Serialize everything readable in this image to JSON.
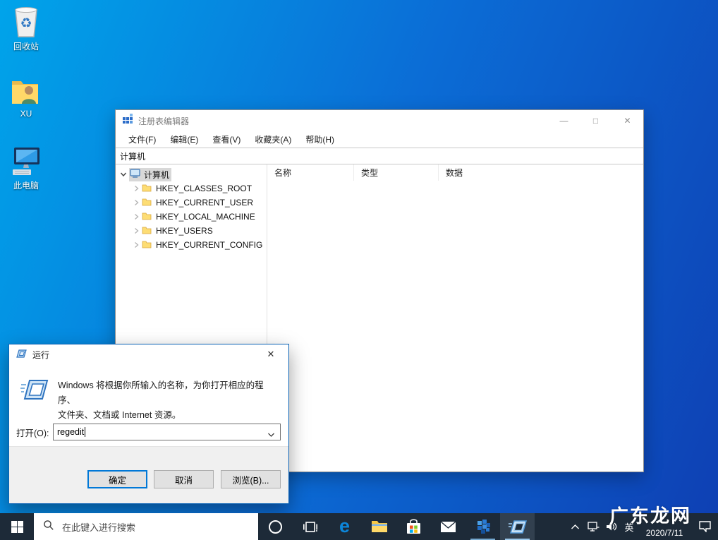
{
  "watermark": {
    "text": "广东龙网"
  },
  "desktop": {
    "icons": [
      {
        "label": "回收站"
      },
      {
        "label": "XU"
      },
      {
        "label": "此电脑"
      }
    ]
  },
  "regedit": {
    "title": "注册表编辑器",
    "window_controls": {
      "minimize": "—",
      "maximize": "□",
      "close": "✕"
    },
    "menus": [
      {
        "label": "文件(F)"
      },
      {
        "label": "编辑(E)"
      },
      {
        "label": "查看(V)"
      },
      {
        "label": "收藏夹(A)"
      },
      {
        "label": "帮助(H)"
      }
    ],
    "address": "计算机",
    "tree": {
      "root": "计算机",
      "keys": [
        {
          "label": "HKEY_CLASSES_ROOT"
        },
        {
          "label": "HKEY_CURRENT_USER"
        },
        {
          "label": "HKEY_LOCAL_MACHINE"
        },
        {
          "label": "HKEY_USERS"
        },
        {
          "label": "HKEY_CURRENT_CONFIG"
        }
      ]
    },
    "columns": [
      {
        "label": "名称"
      },
      {
        "label": "类型"
      },
      {
        "label": "数据"
      }
    ]
  },
  "run_dialog": {
    "title": "运行",
    "close": "✕",
    "description_line1": "Windows 将根据你所输入的名称，为你打开相应的程序、",
    "description_line2": "文件夹、文档或 Internet 资源。",
    "open_label": "打开(O):",
    "input_value": "regedit",
    "buttons": {
      "ok": "确定",
      "cancel": "取消",
      "browse": "浏览(B)..."
    }
  },
  "taskbar": {
    "search_placeholder": "在此键入进行搜索",
    "tray": {
      "ime": "英",
      "date": "2020/7/11"
    }
  },
  "colors": {
    "accent": "#0078d7",
    "desktop_gradient_from": "#00a4ea",
    "desktop_gradient_to": "#0e3fb3",
    "taskbar_bg": "#1d2a38",
    "dialog_border": "#0b63b5"
  }
}
